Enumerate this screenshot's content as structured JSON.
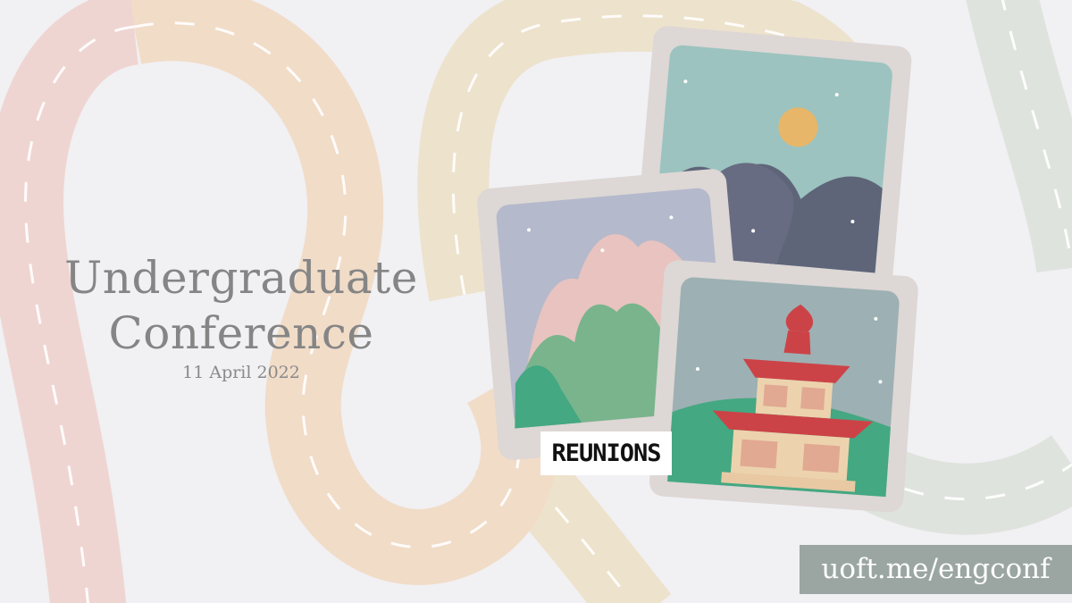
{
  "title": {
    "line1": "Undergraduate",
    "line2": "Conference",
    "date": "11 April 2022"
  },
  "badge": {
    "label": "REUNIONS"
  },
  "link": {
    "url": "uoft.me/engconf"
  },
  "colors": {
    "background": "#f1f0f3",
    "road_pink": "#efd5d1",
    "road_peach": "#f1dcc8",
    "road_cream": "#ede2cc",
    "road_sage": "#dfe3de",
    "frame": "#ddd7d5",
    "title_text": "#858585",
    "url_box": "#9ba6a3",
    "pagoda_red": "#cc4347",
    "hill_green": "#44a882"
  },
  "icons": {
    "photo_1": "mountain-sun-photo",
    "photo_2": "pink-peaks-photo",
    "photo_3": "pagoda-photo"
  }
}
